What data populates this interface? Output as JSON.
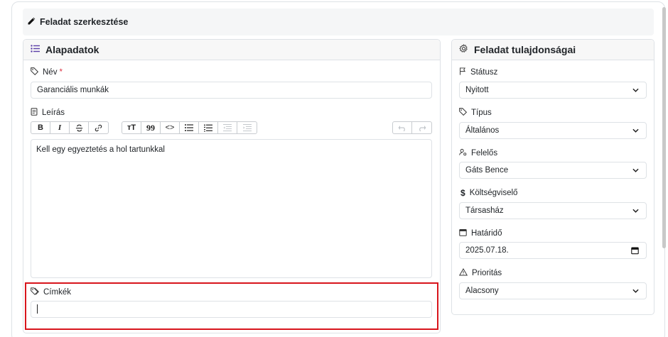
{
  "header": {
    "title": "Feladat szerkesztése"
  },
  "basic": {
    "title": "Alapadatok",
    "name_label": "Név",
    "name_required": "*",
    "name_value": "Garanciális munkák",
    "desc_label": "Leírás",
    "desc_value": "Kell egy egyeztetés a hol tartunkkal",
    "tags_label": "Címkék",
    "tags_value": ""
  },
  "toolbar": {
    "bold": "B",
    "italic": "I",
    "heading": "ᴛT",
    "quote": "99",
    "code": "<>"
  },
  "props": {
    "title": "Feladat tulajdonságai",
    "status_label": "Státusz",
    "status_value": "Nyitott",
    "type_label": "Típus",
    "type_value": "Általános",
    "owner_label": "Felelős",
    "owner_value": "Gáts Bence",
    "cost_label": "Költségviselő",
    "cost_value": "Társasház",
    "deadline_label": "Határidő",
    "deadline_value": "2025.07.18.",
    "priority_label": "Prioritás",
    "priority_value": "Alacsony"
  },
  "icons": {
    "header": "pencil-icon",
    "basic": "list-icon",
    "props": "gear-icon"
  }
}
